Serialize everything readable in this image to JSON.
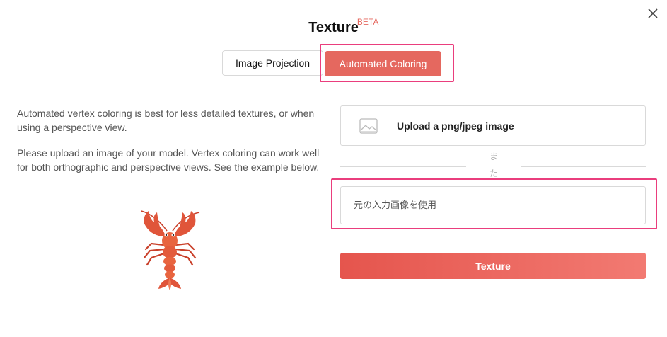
{
  "dialog": {
    "title": "Texture",
    "badge": "BETA",
    "close_icon": "close-icon"
  },
  "tabs": [
    {
      "label": "Image Projection",
      "active": false
    },
    {
      "label": "Automated Coloring",
      "active": true
    }
  ],
  "description": {
    "paragraph1": "Automated vertex coloring is best for less detailed textures, or when using a perspective view.",
    "paragraph2": "Please upload an image of your model. Vertex coloring can work well for both orthographic and perspective views. See the example below.",
    "example_image": "lobster-image"
  },
  "upload": {
    "label": "Upload a png/jpeg image",
    "icon": "image-icon"
  },
  "divider": {
    "text": "また"
  },
  "source_input": {
    "placeholder": "元の入力画像を使用",
    "value": ""
  },
  "submit": {
    "label": "Texture"
  },
  "colors": {
    "accent": "#e5685f",
    "highlight": "#ea3e7d",
    "border": "#d9d9d9"
  }
}
